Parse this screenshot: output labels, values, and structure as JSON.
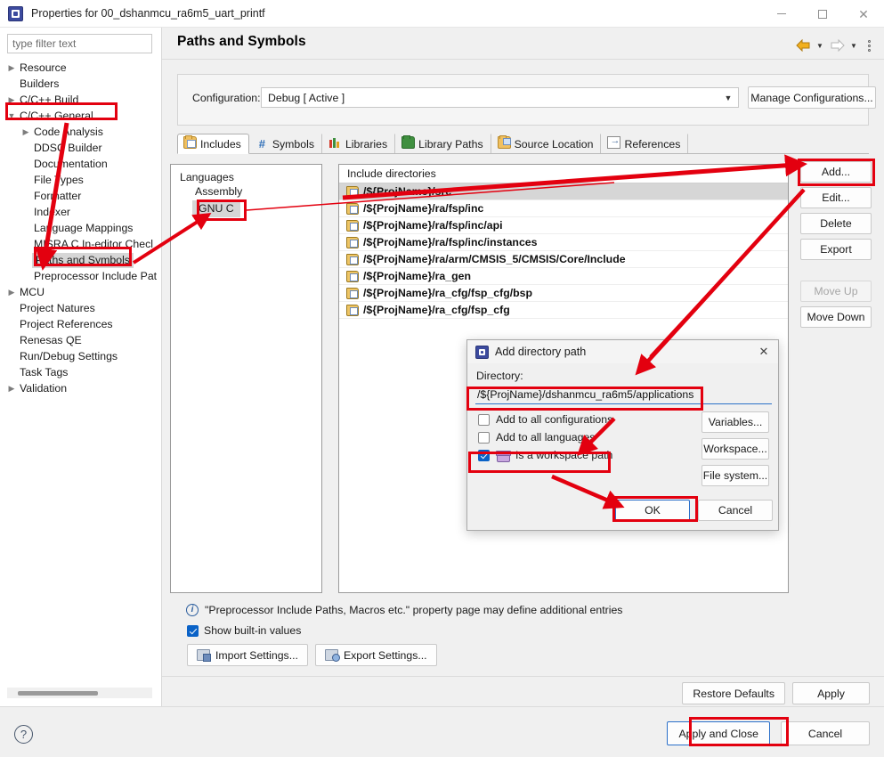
{
  "window": {
    "title": "Properties for 00_dshanmcu_ra6m5_uart_printf",
    "icon": "chip-icon",
    "minimize": "–",
    "maximize": "□",
    "close": "✕"
  },
  "sidebar": {
    "filter_placeholder": "type filter text",
    "filter_value": "",
    "items": [
      {
        "label": "Resource",
        "indent": 1,
        "twisty": "collapsed",
        "selected": false
      },
      {
        "label": "Builders",
        "indent": 1,
        "twisty": "none",
        "selected": false
      },
      {
        "label": "C/C++ Build",
        "indent": 1,
        "twisty": "collapsed",
        "selected": false
      },
      {
        "label": "C/C++ General",
        "indent": 1,
        "twisty": "expanded",
        "selected": false
      },
      {
        "label": "Code Analysis",
        "indent": 2,
        "twisty": "collapsed",
        "selected": false
      },
      {
        "label": "DDSC Builder",
        "indent": 2,
        "twisty": "none",
        "selected": false
      },
      {
        "label": "Documentation",
        "indent": 2,
        "twisty": "none",
        "selected": false
      },
      {
        "label": "File Types",
        "indent": 2,
        "twisty": "none",
        "selected": false
      },
      {
        "label": "Formatter",
        "indent": 2,
        "twisty": "none",
        "selected": false
      },
      {
        "label": "Indexer",
        "indent": 2,
        "twisty": "none",
        "selected": false
      },
      {
        "label": "Language Mappings",
        "indent": 2,
        "twisty": "none",
        "selected": false
      },
      {
        "label": "MISRA C In-editor Checl",
        "indent": 2,
        "twisty": "none",
        "selected": false
      },
      {
        "label": "Paths and Symbols",
        "indent": 2,
        "twisty": "none",
        "selected": true
      },
      {
        "label": "Preprocessor Include Pat",
        "indent": 2,
        "twisty": "none",
        "selected": false
      },
      {
        "label": "MCU",
        "indent": 1,
        "twisty": "collapsed",
        "selected": false
      },
      {
        "label": "Project Natures",
        "indent": 1,
        "twisty": "none",
        "selected": false
      },
      {
        "label": "Project References",
        "indent": 1,
        "twisty": "none",
        "selected": false
      },
      {
        "label": "Renesas QE",
        "indent": 1,
        "twisty": "none",
        "selected": false
      },
      {
        "label": "Run/Debug Settings",
        "indent": 1,
        "twisty": "none",
        "selected": false
      },
      {
        "label": "Task Tags",
        "indent": 1,
        "twisty": "none",
        "selected": false
      },
      {
        "label": "Validation",
        "indent": 1,
        "twisty": "collapsed",
        "selected": false
      }
    ]
  },
  "header": {
    "page_title": "Paths and Symbols",
    "back_icon": "back-arrow-icon",
    "forward_icon": "forward-arrow-icon",
    "menu_icon": "view-menu-icon"
  },
  "configuration": {
    "label": "Configuration:",
    "value": "Debug  [ Active ]",
    "chevron": "∨",
    "manage_button": "Manage Configurations..."
  },
  "tabs": [
    {
      "label": "Includes",
      "icon": "includes-icon",
      "active": true
    },
    {
      "label": "Symbols",
      "icon": "hash-icon",
      "active": false
    },
    {
      "label": "Libraries",
      "icon": "books-icon",
      "active": false
    },
    {
      "label": "Library Paths",
      "icon": "green-folder-icon",
      "active": false
    },
    {
      "label": "Source Location",
      "icon": "source-folder-icon",
      "active": false
    },
    {
      "label": "References",
      "icon": "reference-icon",
      "active": false
    }
  ],
  "languages": {
    "header": "Languages",
    "items": [
      {
        "label": "Assembly",
        "selected": false
      },
      {
        "label": "GNU C",
        "selected": true
      }
    ]
  },
  "include_directories": {
    "header": "Include directories",
    "items": [
      {
        "path": "/${ProjName}/src",
        "selected": true
      },
      {
        "path": "/${ProjName}/ra/fsp/inc",
        "selected": false
      },
      {
        "path": "/${ProjName}/ra/fsp/inc/api",
        "selected": false
      },
      {
        "path": "/${ProjName}/ra/fsp/inc/instances",
        "selected": false
      },
      {
        "path": "/${ProjName}/ra/arm/CMSIS_5/CMSIS/Core/Include",
        "selected": false
      },
      {
        "path": "/${ProjName}/ra_gen",
        "selected": false
      },
      {
        "path": "/${ProjName}/ra_cfg/fsp_cfg/bsp",
        "selected": false
      },
      {
        "path": "/${ProjName}/ra_cfg/fsp_cfg",
        "selected": false
      }
    ]
  },
  "side_buttons": [
    {
      "label": "Add...",
      "enabled": true
    },
    {
      "label": "Edit...",
      "enabled": true
    },
    {
      "label": "Delete",
      "enabled": true
    },
    {
      "label": "Export",
      "enabled": true
    },
    {
      "label": "Move Up",
      "enabled": false
    },
    {
      "label": "Move Down",
      "enabled": true
    }
  ],
  "footer": {
    "info_text": "\"Preprocessor Include Paths, Macros etc.\" property page may define additional entries",
    "info_icon": "info-icon",
    "show_builtin_label": "Show built-in values",
    "show_builtin_checked": true,
    "import_settings": "Import Settings...",
    "export_settings": "Export Settings...",
    "restore_defaults": "Restore Defaults",
    "apply": "Apply",
    "apply_and_close": "Apply and Close",
    "cancel": "Cancel",
    "help_icon": "?"
  },
  "dialog": {
    "title": "Add directory path",
    "icon": "chip-icon",
    "close_icon": "✕",
    "directory_label": "Directory:",
    "directory_value": "/${ProjName}/dshanmcu_ra6m5/applications",
    "checkboxes": [
      {
        "label": "Add to all configurations",
        "checked": false,
        "icon": null
      },
      {
        "label": "Add to all languages",
        "checked": false,
        "icon": null
      },
      {
        "label": "Is a workspace path",
        "checked": true,
        "icon": "workspace-icon"
      }
    ],
    "buttons": {
      "variables": "Variables...",
      "workspace": "Workspace...",
      "file_system": "File system...",
      "ok": "OK",
      "cancel": "Cancel"
    }
  },
  "annotations": {
    "highlight_color": "#e3000f",
    "boxes": [
      "sidebar-cpp-general",
      "sidebar-paths-and-symbols",
      "languages-gnu-c",
      "add-button",
      "dialog-directory-input",
      "dialog-workspace-path-checkbox",
      "dialog-ok-button",
      "apply-and-close-button"
    ]
  }
}
